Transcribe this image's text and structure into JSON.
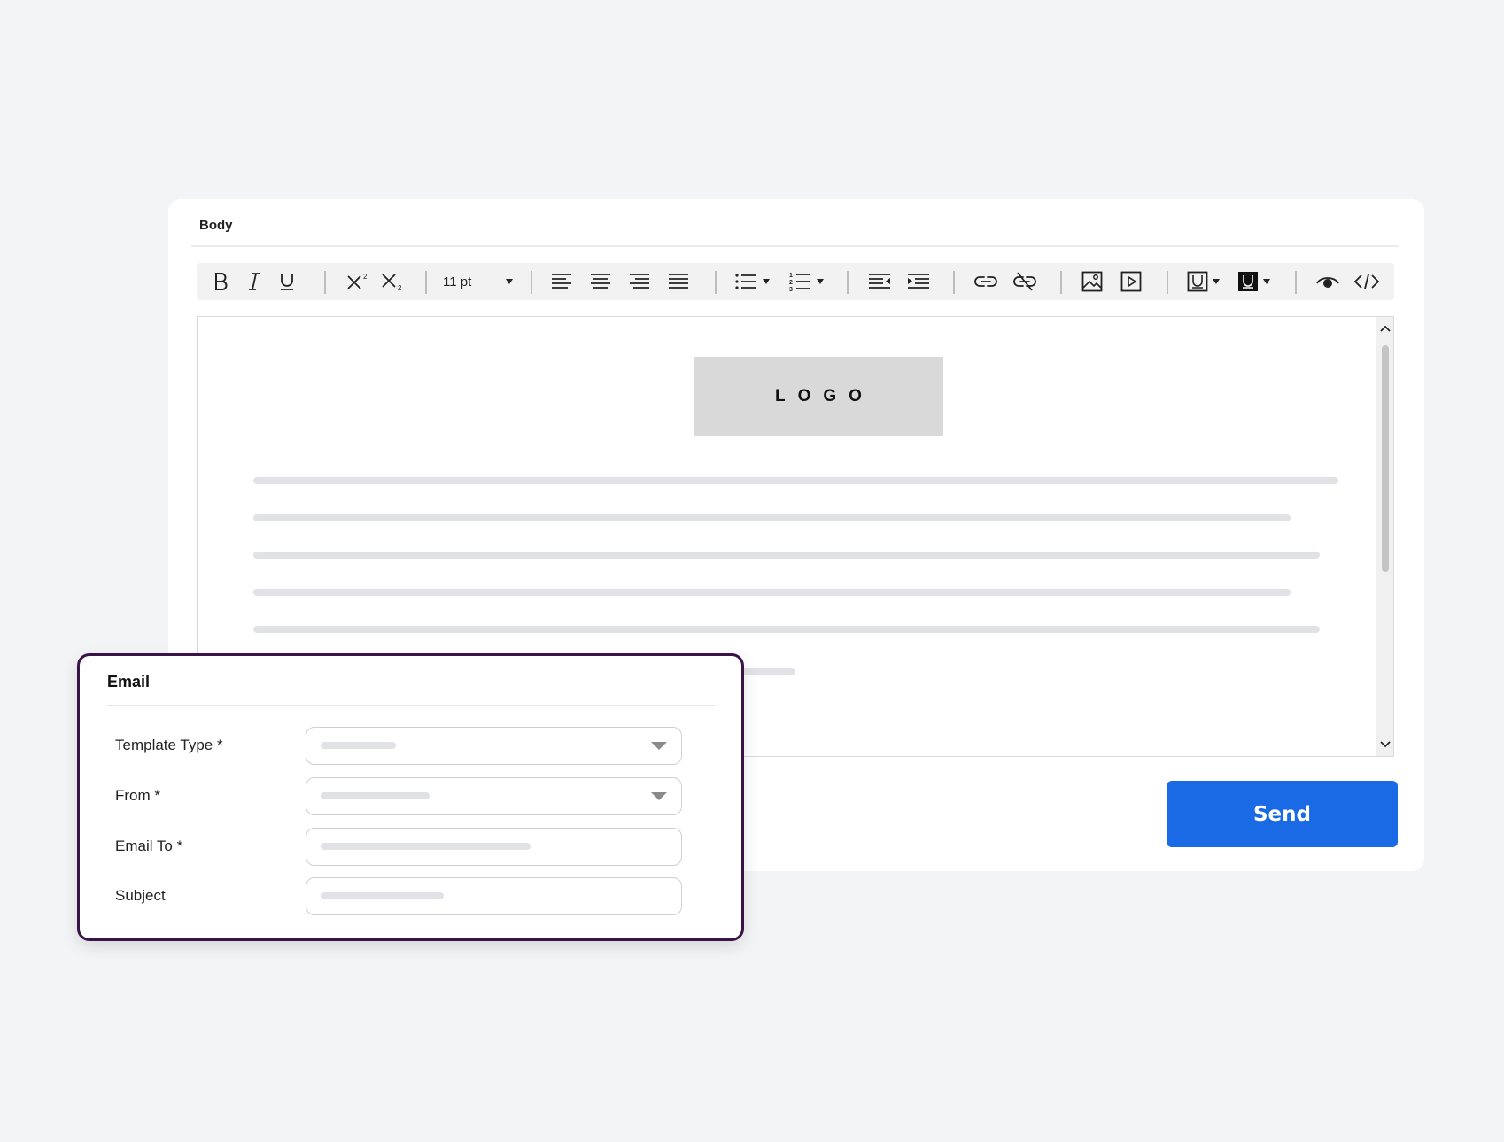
{
  "colors": {
    "accent": "#1a6ae6",
    "email_border": "#3a1448",
    "background": "#f3f4f6",
    "placeholder": "#e1e2e6"
  },
  "editor": {
    "section_label": "Body",
    "toolbar": {
      "font_size": "11 pt",
      "icons": [
        "bold-icon",
        "italic-icon",
        "underline-icon",
        "superscript-icon",
        "subscript-icon",
        "font-size-dropdown",
        "align-left-icon",
        "align-center-icon",
        "align-right-icon",
        "align-justify-icon",
        "bullet-list-icon",
        "numbered-list-icon",
        "outdent-icon",
        "indent-icon",
        "link-icon",
        "unlink-icon",
        "image-icon",
        "video-icon",
        "text-color-icon",
        "highlight-color-icon",
        "preview-icon",
        "code-icon"
      ]
    },
    "content": {
      "logo_text": "LOGO"
    }
  },
  "send_button": {
    "label": "Send"
  },
  "email_form": {
    "title": "Email",
    "fields": [
      {
        "label": "Template Type *",
        "type": "select"
      },
      {
        "label": "From *",
        "type": "select"
      },
      {
        "label": "Email To *",
        "type": "text"
      },
      {
        "label": "Subject",
        "type": "text"
      }
    ]
  }
}
